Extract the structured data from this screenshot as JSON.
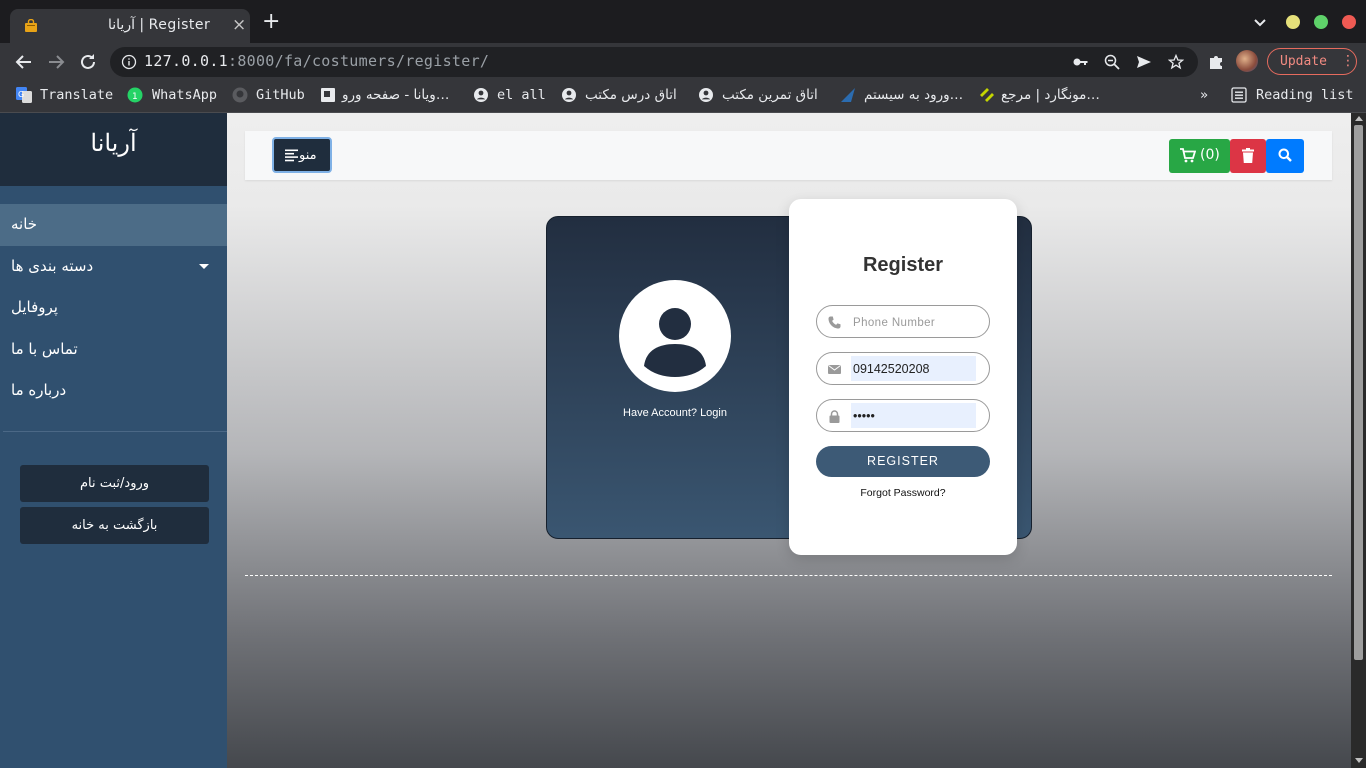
{
  "browser": {
    "tab_title": "آریانا | Register",
    "url_host": "127.0.0.1",
    "url_rest": ":8000/fa/costumers/register/",
    "update_label": "Update",
    "window_dots": {
      "minimize": "#e5e07a",
      "maximize": "#5fd26a",
      "close": "#ef5a53"
    },
    "bookmarks": {
      "translate": "Translate",
      "whatsapp": "WhatsApp",
      "github": "GitHub",
      "viyana": "ویانا - صفحه ورو…",
      "el_all": "el all",
      "otagh_dars": "اتاق درس مکتب",
      "otagh_tamrin": "اتاق تمرین مکتب",
      "vorood": "ورود به سیستم…",
      "mongard": "مونگارد | مرجع…",
      "overflow": "»",
      "reading_list": "Reading list"
    }
  },
  "sidebar": {
    "brand": "آریانا",
    "items": [
      {
        "label": "خانه"
      },
      {
        "label": "دسته بندی ها"
      },
      {
        "label": "پروفایل"
      },
      {
        "label": "تماس با ما"
      },
      {
        "label": "درباره ما"
      }
    ],
    "login_button": "ورود/ثبت نام",
    "back_home_button": "بازگشت به خانه"
  },
  "topnav": {
    "menu_label": "منو",
    "cart_count": "(0)",
    "colors": {
      "cart": "#28a745",
      "delete": "#dc3545",
      "search": "#007bff"
    }
  },
  "register": {
    "have_account": "Have Account? Login",
    "title": "Register",
    "phone_placeholder": "Phone Number",
    "email_value": "09142520208",
    "password_value": "•••••",
    "submit": "REGISTER",
    "forgot": "Forgot Password?"
  }
}
